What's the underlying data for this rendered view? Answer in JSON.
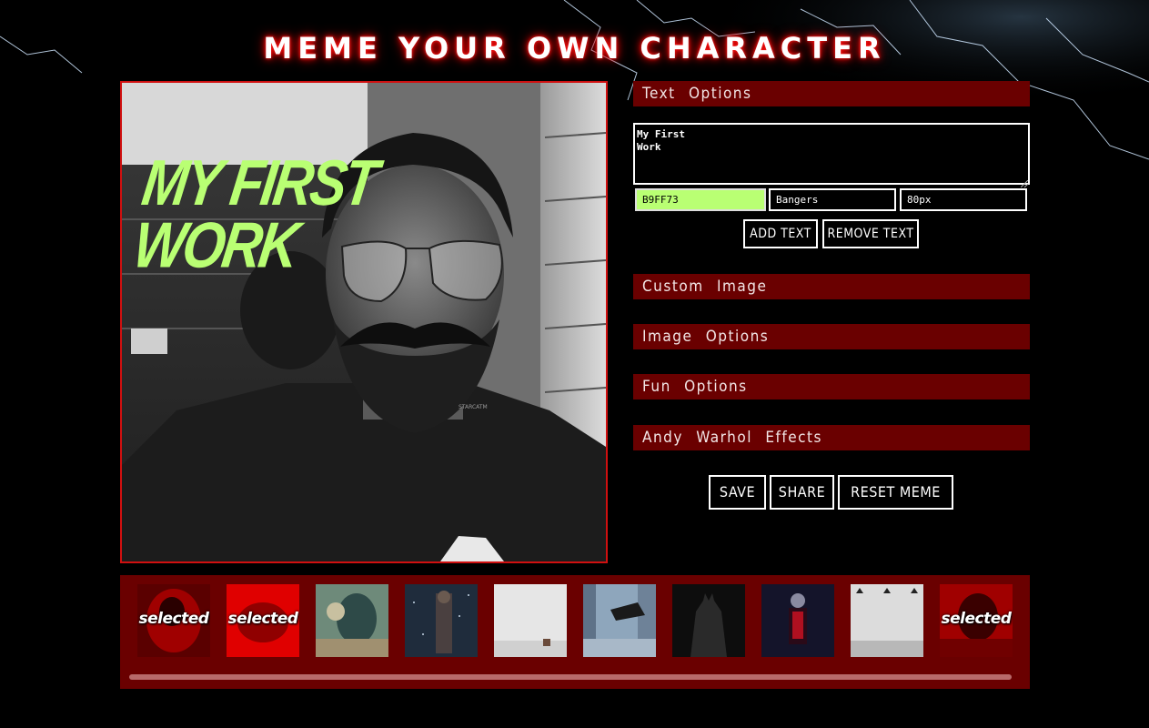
{
  "app": {
    "title": "MEME YOUR OWN CHARACTER"
  },
  "canvas": {
    "meme_text": "MY FIRST\nWORK",
    "watermark": "STARCATM"
  },
  "text_options": {
    "header": "Text Options",
    "textarea_value": "My First\nWork",
    "color_value": "B9FF73",
    "font_value": "Bangers",
    "size_value": "80px",
    "add_label": "ADD TEXT",
    "remove_label": "REMOVE TEXT",
    "text_color": "#b9ff73"
  },
  "sections": {
    "custom_image": "Custom Image",
    "image_options": "Image Options",
    "fun_options": "Fun Options",
    "warhol": "Andy Warhol Effects"
  },
  "actions": {
    "save": "SAVE",
    "share": "SHARE",
    "reset": "RESET MEME"
  },
  "gallery": {
    "selected_label": "selected",
    "thumbnails": [
      {
        "name": "thumb-red-character-1",
        "selected": true
      },
      {
        "name": "thumb-red-splash",
        "selected": true
      },
      {
        "name": "thumb-joker-art",
        "selected": false
      },
      {
        "name": "thumb-bane-snow",
        "selected": false
      },
      {
        "name": "thumb-white-wall-figure",
        "selected": false
      },
      {
        "name": "thumb-batmobile-city",
        "selected": false
      },
      {
        "name": "thumb-batman",
        "selected": false
      },
      {
        "name": "thumb-red-suit-villain",
        "selected": false
      },
      {
        "name": "thumb-brick-wall-lamps",
        "selected": false
      },
      {
        "name": "thumb-red-character-2",
        "selected": true
      }
    ]
  },
  "colors": {
    "accent_red": "#6a0000",
    "frame_red": "#d01010",
    "meme_green": "#b9ff73"
  }
}
